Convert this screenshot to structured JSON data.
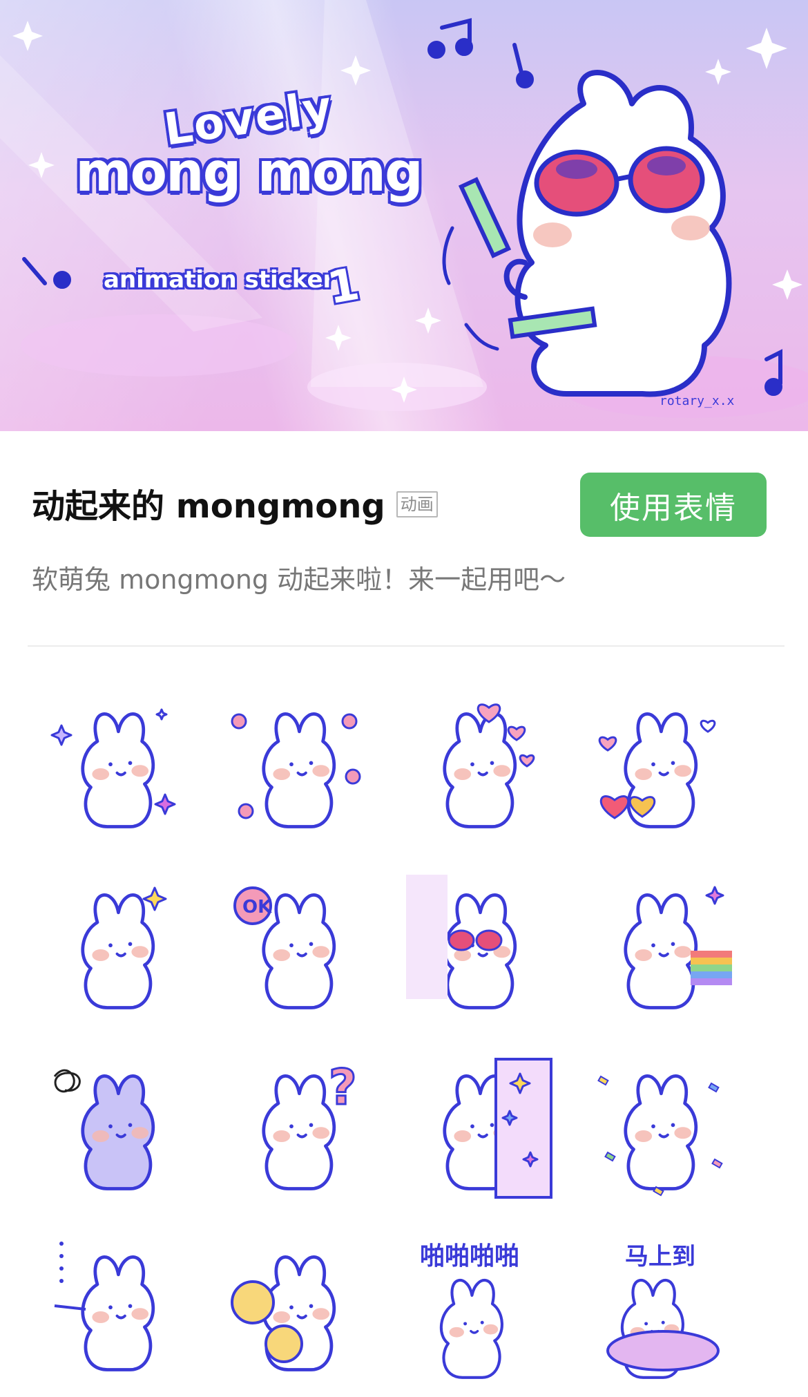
{
  "banner": {
    "title_line1": "Lovely",
    "title_line2": "mong mong",
    "subtitle": "animation sticker",
    "number": "1",
    "credit": "rotary_x.x"
  },
  "pack": {
    "title": "动起来的 mongmong",
    "badge": "动画",
    "use_button": "使用表情",
    "description": "软萌兔 mongmong 动起来啦！来一起用吧～"
  },
  "colors": {
    "accent_green": "#57be69",
    "outline_blue": "#3a3ad8",
    "blush": "#f4b9b0",
    "pink": "#f06fb0",
    "lavender": "#b6a8f4"
  },
  "stickers": [
    {
      "name": "sparkle",
      "caption": ""
    },
    {
      "name": "flowers",
      "caption": ""
    },
    {
      "name": "hearts-float",
      "caption": ""
    },
    {
      "name": "hearts-hug",
      "caption": ""
    },
    {
      "name": "star-think",
      "caption": ""
    },
    {
      "name": "ok-sign",
      "caption": "OK"
    },
    {
      "name": "sunglasses-dance",
      "caption": ""
    },
    {
      "name": "rainbow-zoom",
      "caption": ""
    },
    {
      "name": "tangled-sad",
      "caption": ""
    },
    {
      "name": "question",
      "caption": "?"
    },
    {
      "name": "peek-door",
      "caption": ""
    },
    {
      "name": "confetti",
      "caption": ""
    },
    {
      "name": "sulk",
      "caption": ""
    },
    {
      "name": "cheer-pompom",
      "caption": ""
    },
    {
      "name": "clap",
      "caption": "啪啪啪啪"
    },
    {
      "name": "on-my-way",
      "caption": "马上到"
    }
  ]
}
